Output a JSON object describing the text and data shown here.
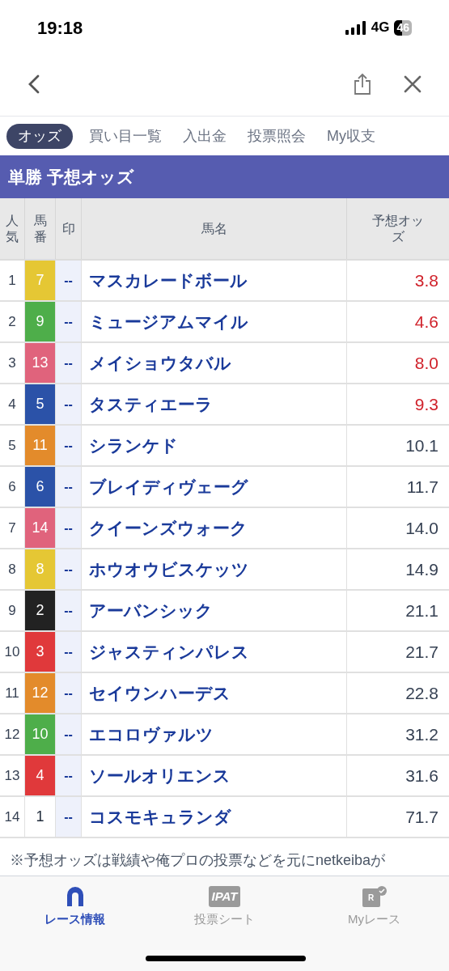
{
  "status_bar": {
    "time": "19:18",
    "network": "4G",
    "battery": "46"
  },
  "tabs": [
    {
      "label": "オッズ",
      "selected": true
    },
    {
      "label": "買い目一覧",
      "selected": false
    },
    {
      "label": "入出金",
      "selected": false
    },
    {
      "label": "投票照会",
      "selected": false
    },
    {
      "label": "My収支",
      "selected": false
    }
  ],
  "section_title": "単勝 予想オッズ",
  "table": {
    "columns": [
      "人気",
      "馬番",
      "印",
      "馬名",
      "予想オッズ"
    ],
    "rows": [
      {
        "rank": "1",
        "number": "7",
        "color": "#e5c734",
        "mark": "--",
        "name": "マスカレードボール",
        "odds": "3.8",
        "emphasized": true
      },
      {
        "rank": "2",
        "number": "9",
        "color": "#4eae4a",
        "mark": "--",
        "name": "ミュージアムマイル",
        "odds": "4.6",
        "emphasized": true
      },
      {
        "rank": "3",
        "number": "13",
        "color": "#e0637c",
        "mark": "--",
        "name": "メイショウタバル",
        "odds": "8.0",
        "emphasized": true
      },
      {
        "rank": "4",
        "number": "5",
        "color": "#2b52a8",
        "mark": "--",
        "name": "タスティエーラ",
        "odds": "9.3",
        "emphasized": true
      },
      {
        "rank": "5",
        "number": "11",
        "color": "#e38b2b",
        "mark": "--",
        "name": "シランケド",
        "odds": "10.1",
        "emphasized": false
      },
      {
        "rank": "6",
        "number": "6",
        "color": "#2b52a8",
        "mark": "--",
        "name": "ブレイディヴェーグ",
        "odds": "11.7",
        "emphasized": false
      },
      {
        "rank": "7",
        "number": "14",
        "color": "#e0637c",
        "mark": "--",
        "name": "クイーンズウォーク",
        "odds": "14.0",
        "emphasized": false
      },
      {
        "rank": "8",
        "number": "8",
        "color": "#e5c734",
        "mark": "--",
        "name": "ホウオウビスケッツ",
        "odds": "14.9",
        "emphasized": false
      },
      {
        "rank": "9",
        "number": "2",
        "color": "#222222",
        "mark": "--",
        "name": "アーバンシック",
        "odds": "21.1",
        "emphasized": false
      },
      {
        "rank": "10",
        "number": "3",
        "color": "#e0393b",
        "mark": "--",
        "name": "ジャスティンパレス",
        "odds": "21.7",
        "emphasized": false
      },
      {
        "rank": "11",
        "number": "12",
        "color": "#e38b2b",
        "mark": "--",
        "name": "セイウンハーデス",
        "odds": "22.8",
        "emphasized": false
      },
      {
        "rank": "12",
        "number": "10",
        "color": "#4eae4a",
        "mark": "--",
        "name": "エコロヴァルツ",
        "odds": "31.2",
        "emphasized": false
      },
      {
        "rank": "13",
        "number": "4",
        "color": "#e0393b",
        "mark": "--",
        "name": "ソールオリエンス",
        "odds": "31.6",
        "emphasized": false
      },
      {
        "rank": "14",
        "number": "1",
        "color": "#ffffff",
        "mark": "--",
        "name": "コスモキュランダ",
        "odds": "71.7",
        "emphasized": false
      }
    ]
  },
  "note": "※予想オッズは戦績や俺プロの投票などを元にnetkeibaが",
  "bottom_tabs": [
    {
      "kind": "horseshoe",
      "label": "レース情報",
      "selected": true
    },
    {
      "kind": "ipat",
      "badge": "IPAT",
      "label": "投票シート",
      "selected": false
    },
    {
      "kind": "myrace",
      "badge": "R",
      "label": "Myレース",
      "selected": false
    }
  ]
}
